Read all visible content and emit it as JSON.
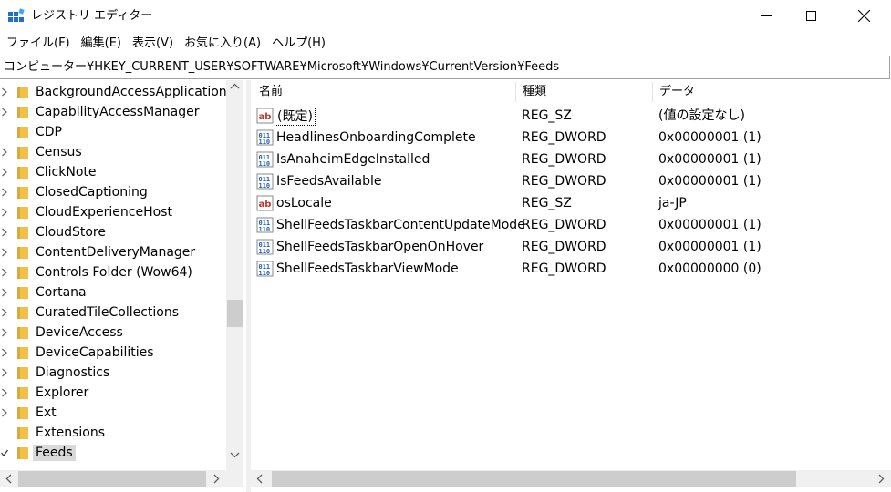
{
  "window": {
    "title": "レジストリ エディター",
    "icon": "registry-editor-icon"
  },
  "menu": [
    "ファイル(F)",
    "編集(E)",
    "表示(V)",
    "お気に入り(A)",
    "ヘルプ(H)"
  ],
  "address": "コンピューター¥HKEY_CURRENT_USER¥SOFTWARE¥Microsoft¥Windows¥CurrentVersion¥Feeds",
  "tree": [
    {
      "label": "BackgroundAccessApplications",
      "expander": "collapsed"
    },
    {
      "label": "CapabilityAccessManager",
      "expander": "collapsed"
    },
    {
      "label": "CDP",
      "expander": "none"
    },
    {
      "label": "Census",
      "expander": "collapsed"
    },
    {
      "label": "ClickNote",
      "expander": "collapsed"
    },
    {
      "label": "ClosedCaptioning",
      "expander": "collapsed"
    },
    {
      "label": "CloudExperienceHost",
      "expander": "collapsed"
    },
    {
      "label": "CloudStore",
      "expander": "collapsed"
    },
    {
      "label": "ContentDeliveryManager",
      "expander": "collapsed"
    },
    {
      "label": "Controls Folder (Wow64)",
      "expander": "collapsed"
    },
    {
      "label": "Cortana",
      "expander": "collapsed"
    },
    {
      "label": "CuratedTileCollections",
      "expander": "collapsed"
    },
    {
      "label": "DeviceAccess",
      "expander": "collapsed"
    },
    {
      "label": "DeviceCapabilities",
      "expander": "collapsed"
    },
    {
      "label": "Diagnostics",
      "expander": "collapsed"
    },
    {
      "label": "Explorer",
      "expander": "collapsed"
    },
    {
      "label": "Ext",
      "expander": "collapsed"
    },
    {
      "label": "Extensions",
      "expander": "none"
    },
    {
      "label": "Feeds",
      "expander": "expanded",
      "selected": true
    }
  ],
  "columns": {
    "name": "名前",
    "type": "種類",
    "data": "データ"
  },
  "values": [
    {
      "icon": "string-value-icon",
      "name": "(既定)",
      "type": "REG_SZ",
      "data": "(値の設定なし)",
      "focused": true
    },
    {
      "icon": "binary-value-icon",
      "name": "HeadlinesOnboardingComplete",
      "type": "REG_DWORD",
      "data": "0x00000001 (1)"
    },
    {
      "icon": "binary-value-icon",
      "name": "IsAnaheimEdgeInstalled",
      "type": "REG_DWORD",
      "data": "0x00000001 (1)"
    },
    {
      "icon": "binary-value-icon",
      "name": "IsFeedsAvailable",
      "type": "REG_DWORD",
      "data": "0x00000001 (1)"
    },
    {
      "icon": "string-value-icon",
      "name": "osLocale",
      "type": "REG_SZ",
      "data": "ja-JP"
    },
    {
      "icon": "binary-value-icon",
      "name": "ShellFeedsTaskbarContentUpdateMode",
      "type": "REG_DWORD",
      "data": "0x00000001 (1)"
    },
    {
      "icon": "binary-value-icon",
      "name": "ShellFeedsTaskbarOpenOnHover",
      "type": "REG_DWORD",
      "data": "0x00000001 (1)"
    },
    {
      "icon": "binary-value-icon",
      "name": "ShellFeedsTaskbarViewMode",
      "type": "REG_DWORD",
      "data": "0x00000000 (0)"
    }
  ],
  "colors": {
    "folder": "#f0c049",
    "selection": "#d9d9d9",
    "scrollbar": "#f0f0f0",
    "thumb": "#cdcdcd"
  }
}
